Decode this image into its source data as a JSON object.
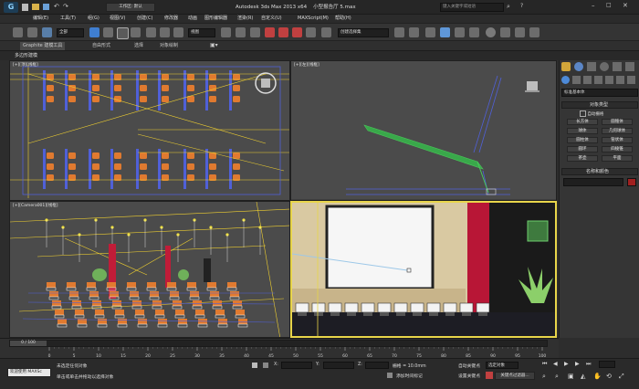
{
  "window": {
    "title": "Autodesk 3ds Max 2013 x64",
    "file": "小型报告厅 5.max",
    "search_placeholder": "键入关键字或短语",
    "workspace": "工作区: 默认"
  },
  "menus": [
    "编辑(E)",
    "工具(T)",
    "组(G)",
    "视图(V)",
    "创建(C)",
    "修改器",
    "动画",
    "图形编辑器",
    "渲染(R)",
    "自定义(U)",
    "MAXScript(M)",
    "帮助(H)"
  ],
  "toolbar": {
    "filter_select": "全部",
    "view_select": "视图",
    "selection_set": "创建选择集"
  },
  "ribbon": {
    "tabs": [
      "Graphite 建模工具",
      "自由形式",
      "选择",
      "对象绘制"
    ],
    "sub_label": "多边形建模"
  },
  "viewports": {
    "top": "[+][顶][线框]",
    "left": "[+][左][线框]",
    "camera": "[+][Camera001][线框]",
    "perspective": ""
  },
  "command_panel": {
    "category": "标准基本体",
    "object_type_header": "对象类型",
    "autogrid": "自动栅格",
    "objects": [
      "长方体",
      "圆锥体",
      "球体",
      "几何球体",
      "圆柱体",
      "管状体",
      "圆环",
      "四棱锥",
      "茶壶",
      "平面"
    ],
    "name_color_header": "名称和颜色"
  },
  "timeline": {
    "frame_counter": "0 / 100",
    "ticks": [
      "0",
      "5",
      "10",
      "15",
      "20",
      "25",
      "30",
      "35",
      "40",
      "45",
      "50",
      "55",
      "60",
      "65",
      "70",
      "75",
      "80",
      "85",
      "90",
      "95",
      "100"
    ]
  },
  "status": {
    "welcome": "欢迎使用 MAXSc",
    "line1": "未选定任何对象",
    "line2": "单击或单击并拖动以选择对象",
    "x_label": "X:",
    "y_label": "Y:",
    "z_label": "Z:",
    "grid": "栅格 = 10.0mm",
    "add_time_tag": "添加时间标记",
    "auto_key": "自动关键点",
    "set_key": "设置关键点",
    "selected_object": "选定对象",
    "key_filter": "关键点过滤器..."
  },
  "colors": {
    "viewport_bg": "#4b4b4b",
    "chair_orange": "#e07a30",
    "wire_yellow": "#f0d030",
    "wire_blue": "#5060d8",
    "curtain_red": "#c01c38"
  }
}
